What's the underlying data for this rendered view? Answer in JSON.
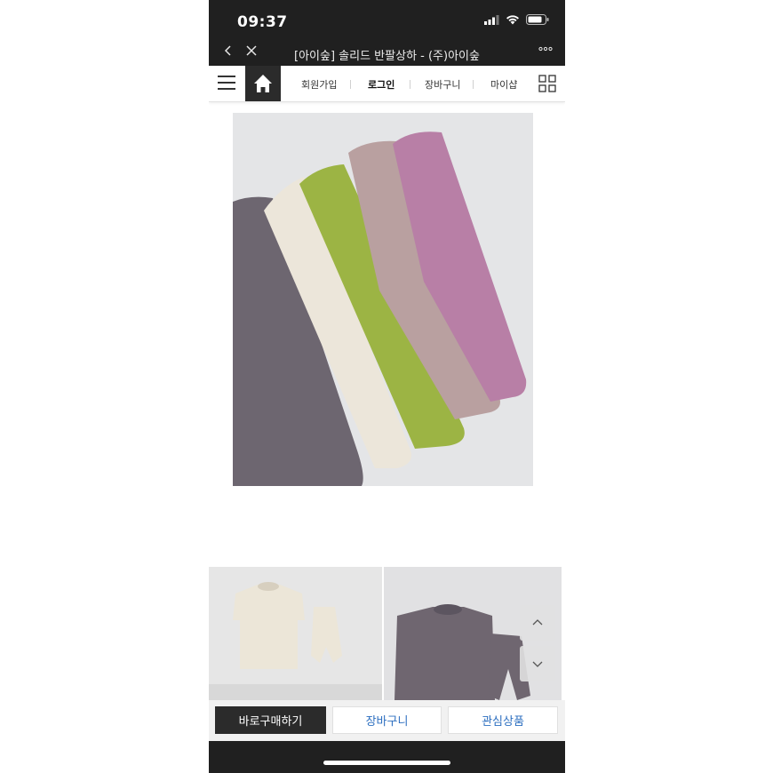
{
  "status_bar": {
    "time": "09:37"
  },
  "browser": {
    "page_title": "[아이숲] 솔리드 반팔상하 - (주)아이숲"
  },
  "site_nav": {
    "links": [
      {
        "label": "회원가입"
      },
      {
        "label": "로그인"
      },
      {
        "label": "장바구니"
      },
      {
        "label": "마이샵"
      }
    ]
  },
  "product": {
    "swatch_colors": [
      "#6d6670",
      "#ece6da",
      "#9cb444",
      "#b9a0a0",
      "#b87fa6"
    ]
  },
  "actions": {
    "buy_label": "바로구매하기",
    "cart_label": "장바구니",
    "wishlist_label": "관심상품"
  }
}
